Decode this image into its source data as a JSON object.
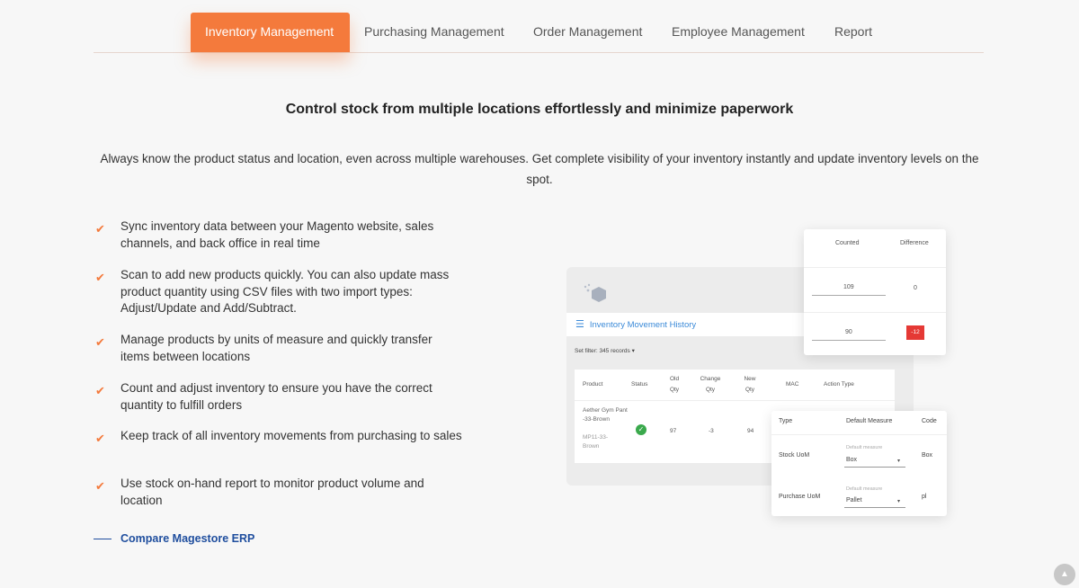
{
  "tabs": [
    {
      "label": "Inventory Management"
    },
    {
      "label": "Purchasing Management"
    },
    {
      "label": "Order Management"
    },
    {
      "label": "Employee Management"
    },
    {
      "label": "Report"
    }
  ],
  "headline": "Control stock from multiple locations effortlessly and minimize paperwork",
  "description": "Always know the product status and location, even across multiple warehouses. Get complete visibility of your inventory instantly and update inventory levels on the spot.",
  "features": [
    "Sync inventory data between your Magento website, sales channels, and back office in real time",
    "Scan to add new products quickly. You can also update mass product quantity using CSV files with two import types: Adjust/Update and Add/Subtract.",
    "Manage products by units of measure and quickly transfer items between locations",
    "Count and adjust inventory to ensure you have the correct quantity to fulfill orders",
    "Keep track of all inventory movements from purchasing to sales",
    "Use stock on-hand report to monitor product volume and location"
  ],
  "compare_link": "Compare Magestore ERP",
  "mockup": {
    "movement_title": "Inventory Movement History",
    "set_filter": "Set filter: 345 records",
    "table_headers": {
      "product": "Product",
      "status": "Status",
      "old_qty": "Old Qty",
      "change_qty": "Change Qty",
      "new_qty": "New Qty",
      "mac": "MAC",
      "action_type": "Action Type"
    },
    "row": {
      "product_name": "Aether Gym Pant -33-Brown",
      "product_sku": "MP11-33-Brown",
      "old_qty": "97",
      "change_qty": "-3",
      "new_qty": "94"
    },
    "counted": {
      "header_counted": "Counted",
      "header_difference": "Difference",
      "row1_counted": "109",
      "row1_difference": "0",
      "row2_counted": "90",
      "row2_difference": "-12"
    },
    "uom": {
      "header_type": "Type",
      "header_default": "Default Measure",
      "header_code": "Code",
      "default_label": "Default measure",
      "row1_type": "Stock UoM",
      "row1_value": "Box",
      "row1_code": "Box",
      "row2_type": "Purchase UoM",
      "row2_value": "Pallet",
      "row2_code": "pl"
    }
  },
  "colors": {
    "accent": "#f47a3c",
    "link": "#1f4e9e",
    "danger": "#e53935",
    "success": "#3aa94c"
  }
}
